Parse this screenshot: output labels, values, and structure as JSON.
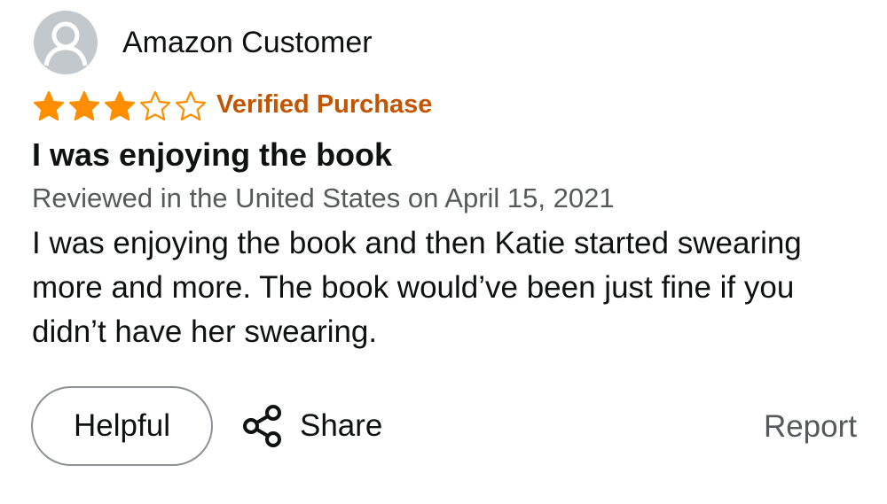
{
  "review": {
    "author": "Amazon Customer",
    "avatar_icon": "user-silhouette-icon",
    "rating": 3,
    "rating_max": 5,
    "star_color": "#ff8f00",
    "verified_label": "Verified Purchase",
    "verified_color": "#c45500",
    "title": "I was enjoying the book",
    "meta": "Reviewed in the United States on April 15, 2021",
    "body": "I was enjoying the book and then Katie started swearing more and more. The book would’ve been just fine if you didn’t have her swearing."
  },
  "actions": {
    "helpful_label": "Helpful",
    "share_label": "Share",
    "share_icon": "share-icon",
    "report_label": "Report"
  }
}
